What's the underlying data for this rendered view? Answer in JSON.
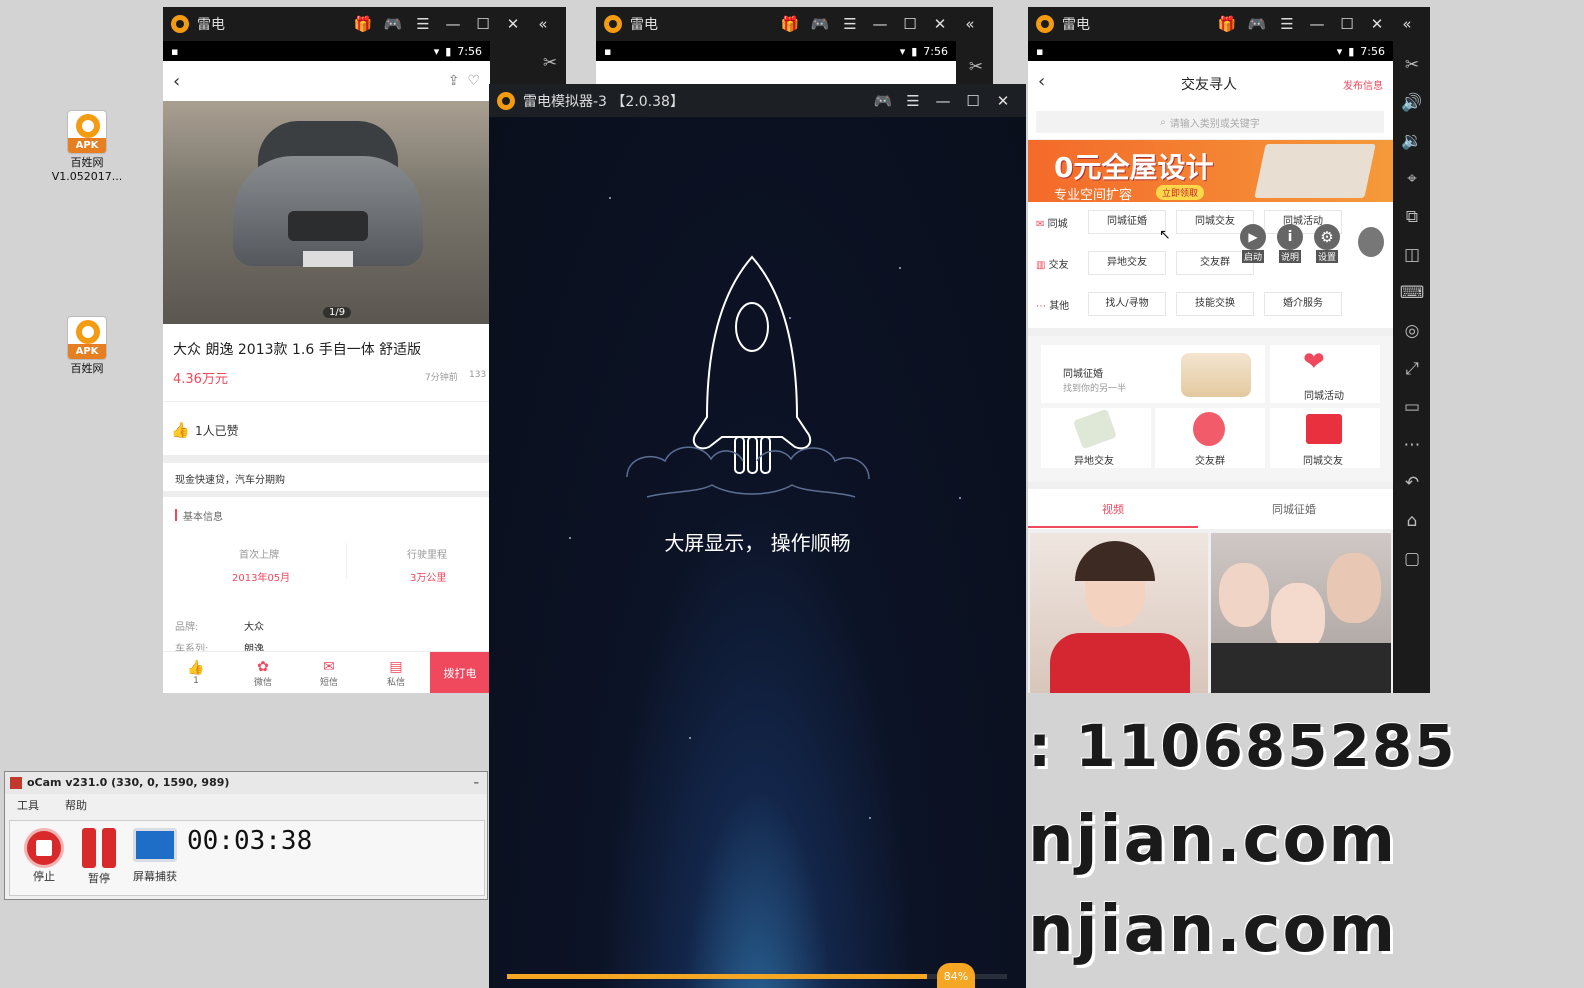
{
  "desktop": {
    "icons": [
      {
        "badge": "APK",
        "label": "百姓网 V1.052017..."
      },
      {
        "badge": "APK",
        "label": "百姓网"
      }
    ]
  },
  "window1": {
    "title": "雷电",
    "status_time": "7:56",
    "photo_counter": "1/9",
    "car_title": "大众 朗逸 2013款 1.6 手自一体 舒适版",
    "price": "4.36万元",
    "posted": "7分钟前",
    "views": "133",
    "likes": "1人已赞",
    "promo": "现金快速贷，汽车分期购",
    "section_title": "基本信息",
    "first_reg_label": "首次上牌",
    "first_reg_value": "2013年05月",
    "mileage_label": "行驶里程",
    "mileage_value": "3万公里",
    "brand_label": "品牌:",
    "brand_value": "大众",
    "series_label": "车系列:",
    "series_value": "朗逸",
    "bottom_bar": [
      {
        "label": "1",
        "icon": "thumb-up-icon"
      },
      {
        "label": "微信",
        "icon": "wechat-icon"
      },
      {
        "label": "短信",
        "icon": "sms-icon"
      },
      {
        "label": "私信",
        "icon": "message-icon"
      }
    ],
    "call_button": "拨打电"
  },
  "window2_back": {
    "title": "雷电",
    "status_time": "7:56"
  },
  "window2": {
    "title": "雷电模拟器-3 【2.0.38】",
    "tagline": "大屏显示， 操作顺畅",
    "progress": 0.84,
    "progress_label": "84%"
  },
  "window3": {
    "title": "雷电",
    "status_time": "7:56",
    "page_title": "交友寻人",
    "publish": "发布信息",
    "search_placeholder": "请输入类别或关键字",
    "banner_main": "0元全屋设计",
    "banner_sub": "专业空间扩容",
    "banner_btn": "立即领取",
    "rows": [
      {
        "head": "同城",
        "items": [
          "同城征婚",
          "同城交友",
          "同城活动"
        ]
      },
      {
        "head": "交友",
        "items": [
          "异地交友",
          "交友群"
        ]
      },
      {
        "head": "其他",
        "items": [
          "找人/寻物",
          "技能交换",
          "婚介服务"
        ]
      }
    ],
    "overlay": [
      {
        "label": "启动",
        "icon": "play-icon"
      },
      {
        "label": "说明",
        "icon": "info-icon"
      },
      {
        "label": "设置",
        "icon": "gear-icon"
      }
    ],
    "tile_big_title": "同城征婚",
    "tile_big_sub": "找到你的另一半",
    "tiles": [
      "同城活动",
      "异地交友",
      "交友群",
      "同城交友"
    ],
    "tabs": [
      "视频",
      "同城征婚"
    ]
  },
  "ocam": {
    "title": "oCam v231.0 (330, 0, 1590, 989)",
    "menu": [
      "工具",
      "帮助"
    ],
    "stop": "停止",
    "pause": "暂停",
    "capture": "屏幕捕获",
    "timer": "00:03:38"
  },
  "watermark": {
    "line1": ": 110685285",
    "line2": "njian.com",
    "line3": "njian.com"
  },
  "colors": {
    "accent": "#f0485d",
    "emulator_bar": "#1b1b1b",
    "progress": "#f5a623"
  }
}
